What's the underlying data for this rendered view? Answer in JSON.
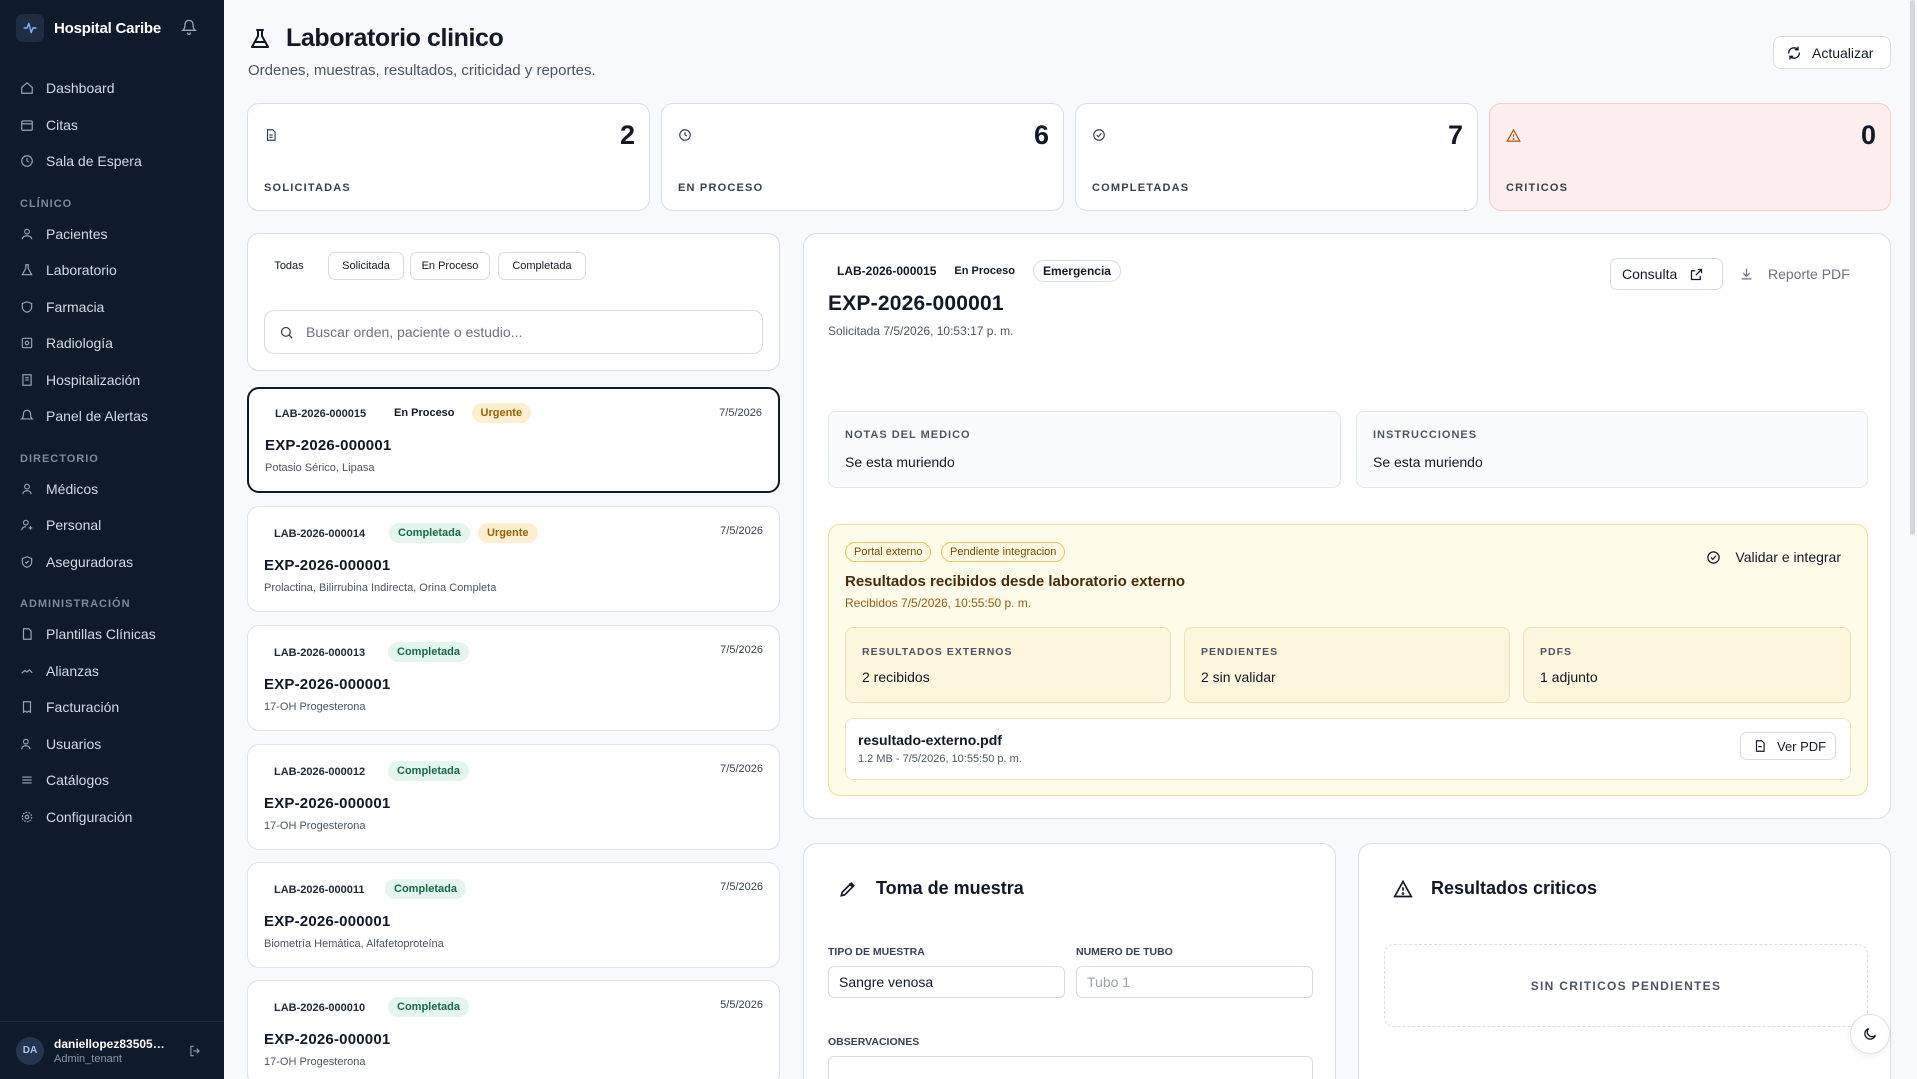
{
  "sidebar": {
    "brand": "Hospital Caribe",
    "items_top": [
      {
        "label": "Dashboard",
        "icon": "home-icon"
      },
      {
        "label": "Citas",
        "icon": "calendar-icon"
      },
      {
        "label": "Sala de Espera",
        "icon": "clock-icon"
      }
    ],
    "sections": [
      {
        "title": "CLÍNICO",
        "items": [
          {
            "label": "Pacientes",
            "icon": "users-icon"
          },
          {
            "label": "Laboratorio",
            "icon": "flask-icon"
          },
          {
            "label": "Farmacia",
            "icon": "shield-icon"
          },
          {
            "label": "Radiología",
            "icon": "scan-icon"
          },
          {
            "label": "Hospitalización",
            "icon": "building-icon"
          },
          {
            "label": "Panel de Alertas",
            "icon": "bell-icon"
          }
        ]
      },
      {
        "title": "DIRECTORIO",
        "items": [
          {
            "label": "Médicos",
            "icon": "user-icon"
          },
          {
            "label": "Personal",
            "icon": "user-plus-icon"
          },
          {
            "label": "Aseguradoras",
            "icon": "shield-check-icon"
          }
        ]
      },
      {
        "title": "ADMINISTRACIÓN",
        "items": [
          {
            "label": "Plantillas Clínicas",
            "icon": "file-icon"
          },
          {
            "label": "Alianzas",
            "icon": "handshake-icon"
          },
          {
            "label": "Facturación",
            "icon": "receipt-icon"
          },
          {
            "label": "Usuarios",
            "icon": "user-cog-icon"
          },
          {
            "label": "Catálogos",
            "icon": "list-icon"
          },
          {
            "label": "Configuración",
            "icon": "gear-icon"
          }
        ]
      }
    ],
    "user": {
      "initials": "DA",
      "name": "daniellopez835050...",
      "role": "Admin_tenant"
    }
  },
  "header": {
    "title": "Laboratorio clinico",
    "subtitle": "Ordenes, muestras, resultados, criticidad y reportes.",
    "refresh_label": "Actualizar"
  },
  "stats": [
    {
      "value": "2",
      "label": "SOLICITADAS"
    },
    {
      "value": "6",
      "label": "EN PROCESO"
    },
    {
      "value": "7",
      "label": "COMPLETADAS"
    },
    {
      "value": "0",
      "label": "CRITICOS"
    }
  ],
  "filters": {
    "chips": [
      "Todas",
      "Solicitada",
      "En Proceso",
      "Completada"
    ],
    "active": "Todas",
    "search_placeholder": "Buscar orden, paciente o estudio..."
  },
  "orders": [
    {
      "code": "LAB-2026-000015",
      "status": "En Proceso",
      "priority": "Urgente",
      "date": "7/5/2026",
      "exp": "EXP-2026-000001",
      "tests": "Potasio Sérico, Lipasa"
    },
    {
      "code": "LAB-2026-000014",
      "status": "Completada",
      "priority": "Urgente",
      "date": "7/5/2026",
      "exp": "EXP-2026-000001",
      "tests": "Prolactina, Bilirrubina Indirecta, Orina Completa"
    },
    {
      "code": "LAB-2026-000013",
      "status": "Completada",
      "priority": "",
      "date": "7/5/2026",
      "exp": "EXP-2026-000001",
      "tests": "17-OH Progesterona"
    },
    {
      "code": "LAB-2026-000012",
      "status": "Completada",
      "priority": "",
      "date": "7/5/2026",
      "exp": "EXP-2026-000001",
      "tests": "17-OH Progesterona"
    },
    {
      "code": "LAB-2026-000011",
      "status": "Completada",
      "priority": "",
      "date": "7/5/2026",
      "exp": "EXP-2026-000001",
      "tests": "Biometría Hemática, Alfafetoproteína"
    },
    {
      "code": "LAB-2026-000010",
      "status": "Completada",
      "priority": "",
      "date": "5/5/2026",
      "exp": "EXP-2026-000001",
      "tests": "17-OH Progesterona"
    }
  ],
  "detail": {
    "code": "LAB-2026-000015",
    "status": "En Proceso",
    "priority": "Emergencia",
    "exp": "EXP-2026-000001",
    "requested": "Solicitada 7/5/2026, 10:53:17 p. m.",
    "consulta_label": "Consulta",
    "pdf_label": "Reporte PDF",
    "notes_title": "NOTAS DEL MEDICO",
    "notes_value": "Se esta muriendo",
    "instr_title": "INSTRUCCIONES",
    "instr_value": "Se esta muriendo",
    "external": {
      "badge1": "Portal externo",
      "badge2": "Pendiente integracion",
      "title": "Resultados recibidos desde laboratorio externo",
      "received": "Recibidos 7/5/2026, 10:55:50 p. m.",
      "validate_label": "Validar e integrar",
      "stats": [
        {
          "title": "RESULTADOS EXTERNOS",
          "value": "2 recibidos"
        },
        {
          "title": "PENDIENTES",
          "value": "2 sin validar"
        },
        {
          "title": "PDFS",
          "value": "1 adjunto"
        }
      ],
      "file_name": "resultado-externo.pdf",
      "file_meta": "1.2 MB - 7/5/2026, 10:55:50 p. m.",
      "view_pdf_label": "Ver PDF"
    }
  },
  "sample": {
    "title": "Toma de muestra",
    "type_label": "TIPO DE MUESTRA",
    "type_value": "Sangre venosa",
    "tube_label": "NUMERO DE TUBO",
    "tube_placeholder": "Tubo 1",
    "obs_label": "OBSERVACIONES"
  },
  "critical": {
    "title": "Resultados criticos",
    "empty": "SIN CRITICOS PENDIENTES"
  },
  "colors": {
    "sidebar_bg": "#0f1a2a",
    "accent_warning": "#fffbe9",
    "critical_bg": "#fdeeee"
  }
}
